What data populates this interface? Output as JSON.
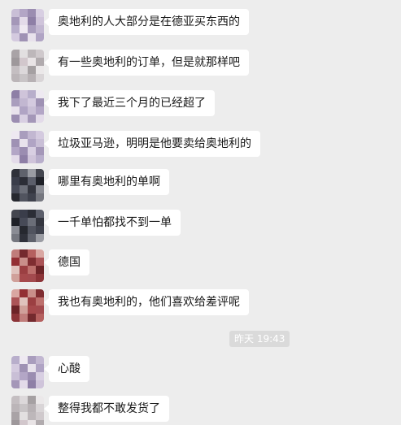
{
  "chat": {
    "messages": [
      {
        "text": "奥地利的人大部分是在德亚买东西的",
        "avatar": "lavender"
      },
      {
        "text": "有一些奥地利的订单，但是就那样吧",
        "avatar": "gray"
      },
      {
        "text": "我下了最近三个月的已经超了",
        "avatar": "lavender"
      },
      {
        "text": "垃圾亚马逊，明明是他要卖给奥地利的",
        "avatar": "lavender"
      },
      {
        "text": "哪里有奥地利的单啊",
        "avatar": "dark"
      },
      {
        "text": "一千单怕都找不到一单",
        "avatar": "dark"
      },
      {
        "text": "德国",
        "avatar": "red"
      },
      {
        "text": "我也有奥地利的，他们喜欢给差评呢",
        "avatar": "red"
      },
      {
        "text": "心酸",
        "avatar": "lavender"
      },
      {
        "text": "整得我都不敢发货了",
        "avatar": "gray"
      }
    ],
    "timestamp": "昨天 19:43"
  },
  "colors": {
    "background": "#ededed",
    "bubble": "#ffffff",
    "text": "#191919",
    "timestamp_bg": "#dadada",
    "timestamp_text": "#ffffff"
  }
}
